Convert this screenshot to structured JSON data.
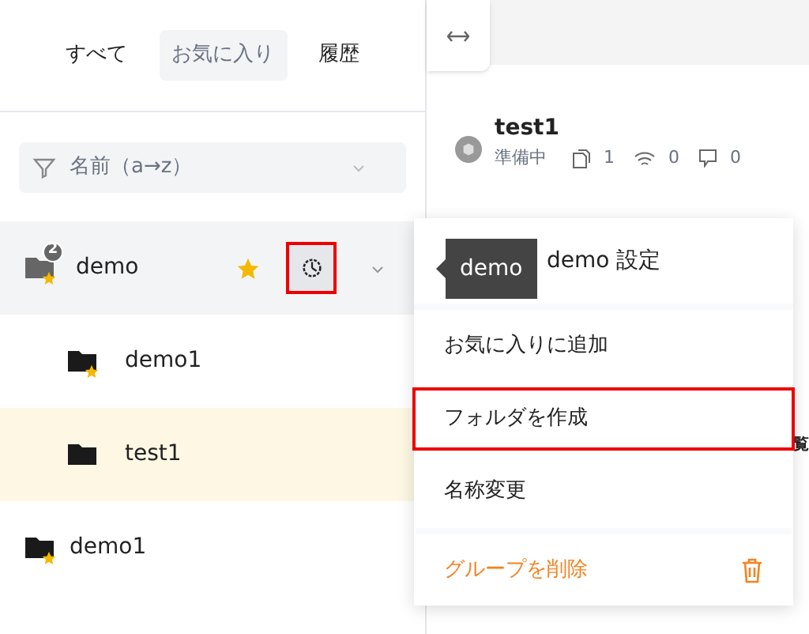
{
  "tabs": [
    {
      "label": "すべて",
      "selected": false
    },
    {
      "label": "お気に入り",
      "selected": true
    },
    {
      "label": "履歴",
      "selected": false
    }
  ],
  "sort_select": {
    "value": "名前（a→z）"
  },
  "tree": [
    {
      "name": "demo",
      "badge": "2",
      "favorite": true,
      "selected": true,
      "expanded": true,
      "gear_highlighted": true,
      "children": [
        {
          "name": "demo1",
          "favorite": true,
          "selected": false
        },
        {
          "name": "test1",
          "favorite": false,
          "selected": true
        }
      ]
    },
    {
      "name": "demo1",
      "favorite": true,
      "selected": false
    }
  ],
  "detail": {
    "title": "test1",
    "status": "準備中",
    "files": "1",
    "wifi": "0",
    "messages": "0",
    "partial_text": "覧"
  },
  "tooltip": "demo",
  "menu": {
    "title": "demo 設定",
    "items": [
      {
        "label": "お気に入りに追加",
        "kind": "normal",
        "highlighted": false
      },
      {
        "label": "フォルダを作成",
        "kind": "normal",
        "highlighted": true
      },
      {
        "label": "名称変更",
        "kind": "normal",
        "highlighted": false
      },
      {
        "label": "グループを削除",
        "kind": "danger",
        "highlighted": false
      }
    ]
  }
}
